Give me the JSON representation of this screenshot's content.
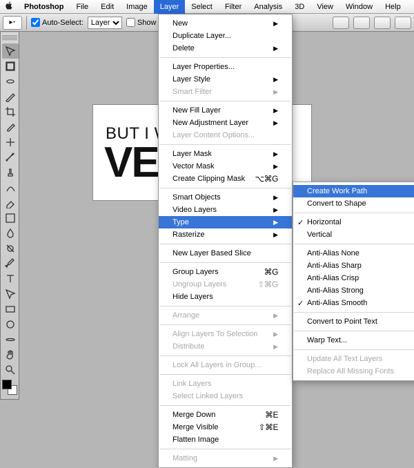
{
  "menubar": {
    "items": [
      "Photoshop",
      "File",
      "Edit",
      "Image",
      "Layer",
      "Select",
      "Filter",
      "Analysis",
      "3D",
      "View",
      "Window",
      "Help"
    ],
    "selected_index": 4
  },
  "options_bar": {
    "auto_select_label": "Auto-Select:",
    "auto_select_value": "Layer",
    "show_transform_label": "Show Transfor"
  },
  "canvas": {
    "line1": "BUT I W",
    "line2": "VE"
  },
  "layer_menu": [
    {
      "label": "New",
      "arrow": true
    },
    {
      "label": "Duplicate Layer..."
    },
    {
      "label": "Delete",
      "arrow": true
    },
    {
      "sep": true
    },
    {
      "label": "Layer Properties..."
    },
    {
      "label": "Layer Style",
      "arrow": true
    },
    {
      "label": "Smart Filter",
      "arrow": true,
      "disabled": true
    },
    {
      "sep": true
    },
    {
      "label": "New Fill Layer",
      "arrow": true
    },
    {
      "label": "New Adjustment Layer",
      "arrow": true
    },
    {
      "label": "Layer Content Options...",
      "disabled": true
    },
    {
      "sep": true
    },
    {
      "label": "Layer Mask",
      "arrow": true
    },
    {
      "label": "Vector Mask",
      "arrow": true
    },
    {
      "label": "Create Clipping Mask",
      "shortcut": "⌥⌘G"
    },
    {
      "sep": true
    },
    {
      "label": "Smart Objects",
      "arrow": true
    },
    {
      "label": "Video Layers",
      "arrow": true
    },
    {
      "label": "Type",
      "arrow": true,
      "highlighted": true
    },
    {
      "label": "Rasterize",
      "arrow": true
    },
    {
      "sep": true
    },
    {
      "label": "New Layer Based Slice"
    },
    {
      "sep": true
    },
    {
      "label": "Group Layers",
      "shortcut": "⌘G"
    },
    {
      "label": "Ungroup Layers",
      "shortcut": "⇧⌘G",
      "disabled": true
    },
    {
      "label": "Hide Layers"
    },
    {
      "sep": true
    },
    {
      "label": "Arrange",
      "arrow": true,
      "disabled": true
    },
    {
      "sep": true
    },
    {
      "label": "Align Layers To Selection",
      "arrow": true,
      "disabled": true
    },
    {
      "label": "Distribute",
      "arrow": true,
      "disabled": true
    },
    {
      "sep": true
    },
    {
      "label": "Lock All Layers in Group...",
      "disabled": true
    },
    {
      "sep": true
    },
    {
      "label": "Link Layers",
      "disabled": true
    },
    {
      "label": "Select Linked Layers",
      "disabled": true
    },
    {
      "sep": true
    },
    {
      "label": "Merge Down",
      "shortcut": "⌘E"
    },
    {
      "label": "Merge Visible",
      "shortcut": "⇧⌘E"
    },
    {
      "label": "Flatten Image"
    },
    {
      "sep": true
    },
    {
      "label": "Matting",
      "arrow": true,
      "disabled": true
    }
  ],
  "type_submenu": [
    {
      "label": "Create Work Path",
      "highlighted": true
    },
    {
      "label": "Convert to Shape"
    },
    {
      "sep": true
    },
    {
      "label": "Horizontal",
      "checked": true
    },
    {
      "label": "Vertical"
    },
    {
      "sep": true
    },
    {
      "label": "Anti-Alias None"
    },
    {
      "label": "Anti-Alias Sharp"
    },
    {
      "label": "Anti-Alias Crisp"
    },
    {
      "label": "Anti-Alias Strong"
    },
    {
      "label": "Anti-Alias Smooth",
      "checked": true
    },
    {
      "sep": true
    },
    {
      "label": "Convert to Point Text"
    },
    {
      "sep": true
    },
    {
      "label": "Warp Text..."
    },
    {
      "sep": true
    },
    {
      "label": "Update All Text Layers",
      "disabled": true
    },
    {
      "label": "Replace All Missing Fonts",
      "disabled": true
    }
  ],
  "tools": [
    "move",
    "marquee",
    "lasso",
    "wand",
    "crop",
    "eyedropper",
    "heal",
    "brush",
    "stamp",
    "history",
    "eraser",
    "gradient",
    "blur",
    "dodge",
    "pen",
    "type",
    "path-sel",
    "shape",
    "3d-rotate",
    "3d-orbit",
    "hand",
    "zoom"
  ]
}
